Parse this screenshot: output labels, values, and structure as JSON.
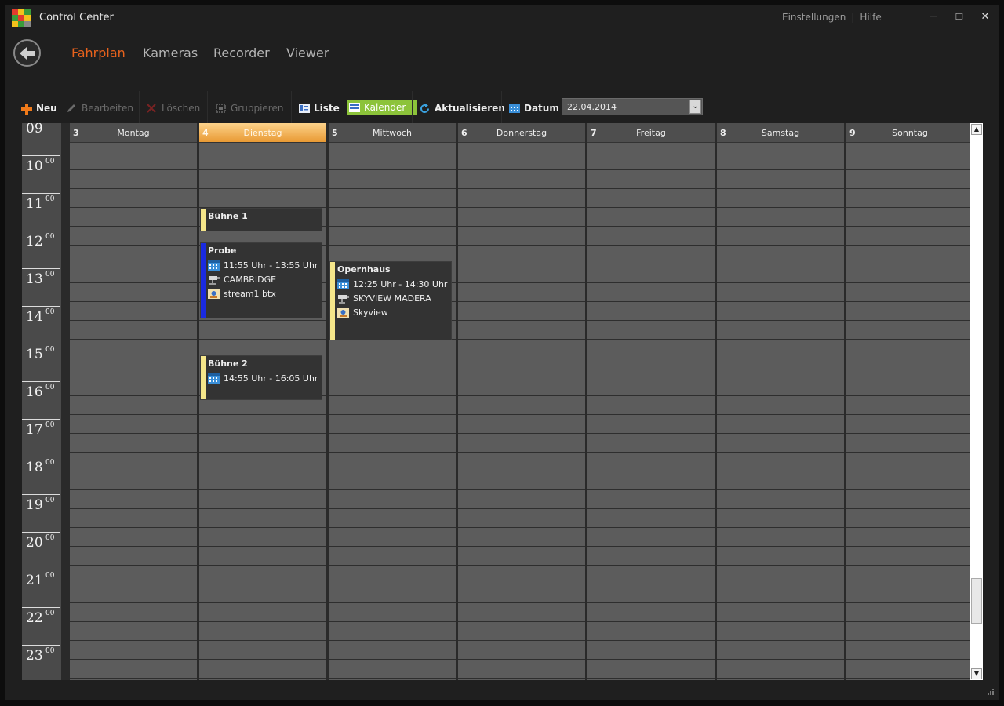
{
  "window": {
    "title": "Control Center",
    "top_links": [
      "Einstellungen",
      "Hilfe"
    ],
    "separator": "|",
    "controls": {
      "minimize": "─",
      "maximize": "❐",
      "close": "✕"
    }
  },
  "nav": {
    "tabs": [
      {
        "label": "Fahrplan",
        "active": true
      },
      {
        "label": "Kameras",
        "active": false
      },
      {
        "label": "Recorder",
        "active": false
      },
      {
        "label": "Viewer",
        "active": false
      }
    ]
  },
  "toolbar": {
    "new_label": "Neu",
    "edit_label": "Bearbeiten",
    "delete_label": "Löschen",
    "group_label": "Gruppieren",
    "list_label": "Liste",
    "calendar_label": "Kalender",
    "refresh_label": "Aktualisieren",
    "date_label": "Datum",
    "date_value": "22.04.2014",
    "dropdown_glyph": "⌄"
  },
  "calendar": {
    "hours": [
      {
        "h": "09",
        "m": ""
      },
      {
        "h": "10",
        "m": "00"
      },
      {
        "h": "11",
        "m": "00"
      },
      {
        "h": "12",
        "m": "00"
      },
      {
        "h": "13",
        "m": "00"
      },
      {
        "h": "14",
        "m": "00"
      },
      {
        "h": "15",
        "m": "00"
      },
      {
        "h": "16",
        "m": "00"
      },
      {
        "h": "17",
        "m": "00"
      },
      {
        "h": "18",
        "m": "00"
      },
      {
        "h": "19",
        "m": "00"
      },
      {
        "h": "20",
        "m": "00"
      },
      {
        "h": "21",
        "m": "00"
      },
      {
        "h": "22",
        "m": "00"
      },
      {
        "h": "23",
        "m": "00"
      }
    ],
    "days": [
      {
        "num": "3",
        "name": "Montag",
        "today": false
      },
      {
        "num": "4",
        "name": "Dienstag",
        "today": true
      },
      {
        "num": "5",
        "name": "Mittwoch",
        "today": false
      },
      {
        "num": "6",
        "name": "Donnerstag",
        "today": false
      },
      {
        "num": "7",
        "name": "Freitag",
        "today": false
      },
      {
        "num": "8",
        "name": "Samstag",
        "today": false
      },
      {
        "num": "9",
        "name": "Sonntag",
        "today": false
      }
    ],
    "events": [
      {
        "day": 1,
        "title": "Bühne 1",
        "color": "#f5e68a",
        "lines": []
      },
      {
        "day": 1,
        "title": "Probe",
        "color": "#1a2ae0",
        "lines": [
          {
            "icon": "calendar-icon",
            "text": "11:55 Uhr - 13:55 Uhr"
          },
          {
            "icon": "camera-icon",
            "text": "CAMBRIDGE"
          },
          {
            "icon": "stream-icon",
            "text": "stream1 btx"
          }
        ]
      },
      {
        "day": 2,
        "title": "Opernhaus",
        "color": "#f5e68a",
        "lines": [
          {
            "icon": "calendar-icon",
            "text": "12:25 Uhr - 14:30 Uhr"
          },
          {
            "icon": "camera-icon",
            "text": "SKYVIEW MADERA"
          },
          {
            "icon": "stream-icon",
            "text": "Skyview"
          }
        ]
      },
      {
        "day": 1,
        "title": "Bühne 2",
        "color": "#f5e68a",
        "lines": [
          {
            "icon": "calendar-icon",
            "text": "14:55 Uhr - 16:05 Uhr"
          }
        ]
      }
    ]
  },
  "scrollbar": {
    "up": "▲",
    "down": "▼"
  }
}
